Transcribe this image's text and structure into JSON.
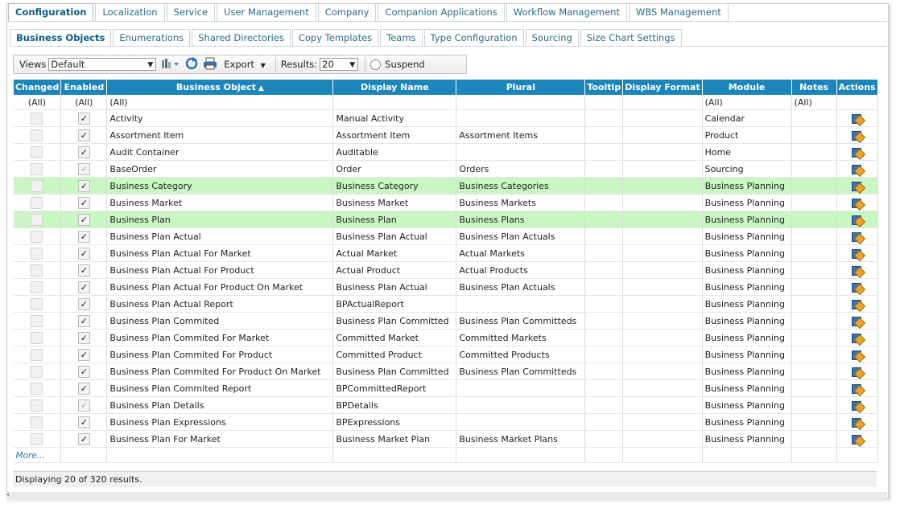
{
  "main_tabs": [
    {
      "label": "Configuration",
      "active": true
    },
    {
      "label": "Localization"
    },
    {
      "label": "Service"
    },
    {
      "label": "User Management"
    },
    {
      "label": "Company"
    },
    {
      "label": "Companion Applications"
    },
    {
      "label": "Workflow Management"
    },
    {
      "label": "WBS Management"
    }
  ],
  "sub_tabs": [
    {
      "label": "Business Objects",
      "active": true
    },
    {
      "label": "Enumerations"
    },
    {
      "label": "Shared Directories"
    },
    {
      "label": "Copy Templates"
    },
    {
      "label": "Teams"
    },
    {
      "label": "Type Configuration"
    },
    {
      "label": "Sourcing"
    },
    {
      "label": "Size Chart Settings"
    }
  ],
  "toolbar": {
    "views_label": "Views",
    "views_value": "Default",
    "export_label": "Export",
    "results_label": "Results:",
    "results_value": "20",
    "suspend_label": "Suspend"
  },
  "columns": {
    "changed": "Changed",
    "enabled": "Enabled",
    "business_object": "Business Object",
    "display_name": "Display Name",
    "plural": "Plural",
    "tooltip": "Tooltip",
    "display_format": "Display Format",
    "module": "Module",
    "notes": "Notes",
    "actions": "Actions"
  },
  "filters": {
    "changed": "(All)",
    "enabled": "(All)",
    "business_object": "(All)",
    "module": "(All)",
    "notes": "(All)"
  },
  "rows": [
    {
      "enabled": "checked",
      "object": "Activity",
      "display": "Manual Activity",
      "plural": "",
      "module": "Calendar"
    },
    {
      "enabled": "checked",
      "object": "Assortment Item",
      "display": "Assortment Item",
      "plural": "Assortment Items",
      "module": "Product"
    },
    {
      "enabled": "checked",
      "object": "Audit Container",
      "display": "Auditable",
      "plural": "",
      "module": "Home"
    },
    {
      "enabled": "dim",
      "object": "BaseOrder",
      "display": "Order",
      "plural": "Orders",
      "module": "Sourcing"
    },
    {
      "enabled": "checked",
      "object": "Business Category",
      "display": "Business Category",
      "plural": "Business Categories",
      "module": "Business Planning",
      "highlight": true
    },
    {
      "enabled": "checked",
      "object": "Business Market",
      "display": "Business Market",
      "plural": "Business Markets",
      "module": "Business Planning"
    },
    {
      "enabled": "checked",
      "object": "Business Plan",
      "display": "Business Plan",
      "plural": "Business Plans",
      "module": "Business Planning",
      "highlight": true
    },
    {
      "enabled": "checked",
      "object": "Business Plan Actual",
      "display": "Business Plan Actual",
      "plural": "Business Plan Actuals",
      "module": "Business Planning"
    },
    {
      "enabled": "checked",
      "object": "Business Plan Actual For Market",
      "display": "Actual Market",
      "plural": "Actual Markets",
      "module": "Business Planning"
    },
    {
      "enabled": "checked",
      "object": "Business Plan Actual For Product",
      "display": "Actual Product",
      "plural": "Actual Products",
      "module": "Business Planning"
    },
    {
      "enabled": "checked",
      "object": "Business Plan Actual For Product On Market",
      "display": "Business Plan Actual",
      "plural": "Business Plan Actuals",
      "module": "Business Planning"
    },
    {
      "enabled": "checked",
      "object": "Business Plan Actual Report",
      "display": "BPActualReport",
      "plural": "",
      "module": "Business Planning"
    },
    {
      "enabled": "checked",
      "object": "Business Plan Commited",
      "display": "Business Plan Committed",
      "plural": "Business Plan Committeds",
      "module": "Business Planning"
    },
    {
      "enabled": "checked",
      "object": "Business Plan Commited For Market",
      "display": "Committed Market",
      "plural": "Committed Markets",
      "module": "Business Planning"
    },
    {
      "enabled": "checked",
      "object": "Business Plan Commited For Product",
      "display": "Committed Product",
      "plural": "Committed Products",
      "module": "Business Planning"
    },
    {
      "enabled": "checked",
      "object": "Business Plan Commited For Product On Market",
      "display": "Business Plan Committed",
      "plural": "Business Plan Committeds",
      "module": "Business Planning"
    },
    {
      "enabled": "checked",
      "object": "Business Plan Commited Report",
      "display": "BPCommittedReport",
      "plural": "",
      "module": "Business Planning"
    },
    {
      "enabled": "dim",
      "object": "Business Plan Details",
      "display": "BPDetails",
      "plural": "",
      "module": "Business Planning"
    },
    {
      "enabled": "checked",
      "object": "Business Plan Expressions",
      "display": "BPExpressions",
      "plural": "",
      "module": "Business Planning"
    },
    {
      "enabled": "checked",
      "object": "Business Plan For Market",
      "display": "Business Market Plan",
      "plural": "Business Market Plans",
      "module": "Business Planning"
    }
  ],
  "more_label": "More...",
  "status": "Displaying 20 of 320 results.",
  "icons": {
    "export": "export-icon",
    "refresh": "refresh-icon",
    "print": "printer-icon",
    "action": "edit-object-icon",
    "sort": "sort-ascending-icon"
  }
}
